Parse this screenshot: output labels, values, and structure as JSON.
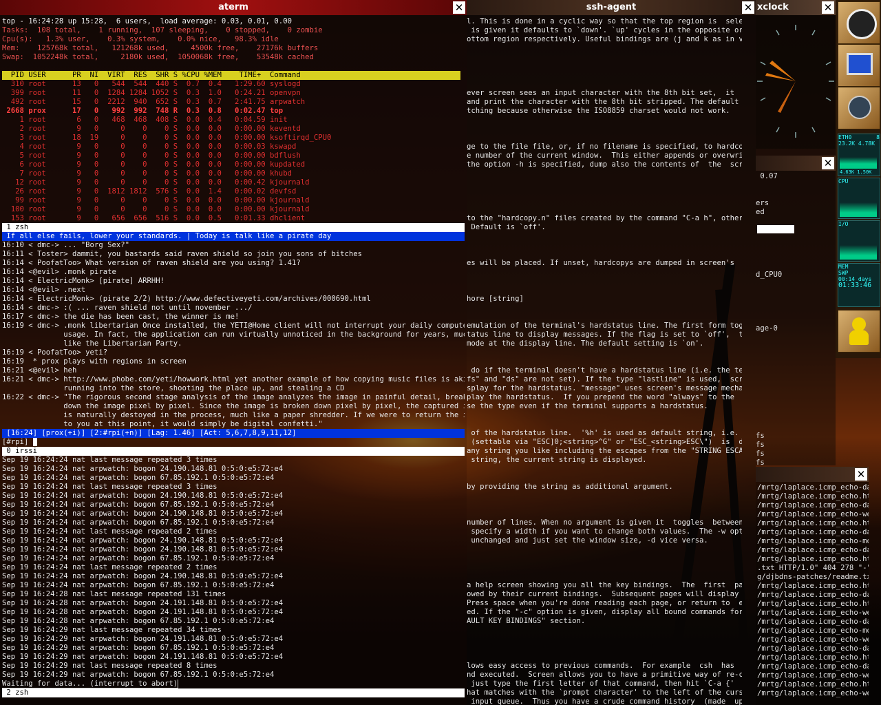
{
  "top_window": {
    "title": "aterm",
    "header": [
      "top - 16:24:28 up 15:28,  6 users,  load average: 0.03, 0.01, 0.00",
      "Tasks:  108 total,    1 running,  107 sleeping,    0 stopped,    0 zombie",
      "Cpu(s):   1.3% user,    0.3% system,    0.0% nice,   98.3% idle",
      "Mem:    125768k total,   121268k used,     4500k free,    27176k buffers",
      "Swap:  1052248k total,     2180k used,  1050068k free,    53548k cached"
    ],
    "columns_header": "  PID USER      PR  NI  VIRT  RES  SHR S %CPU %MEM    TIME+  Command          ",
    "processes": [
      "  310 root      13   0   544  544  440 S  0.7  0.4   1:29.60 syslogd",
      "  399 root      11   0  1284 1284 1052 S  0.3  1.0   0:24.21 openvpn",
      "  492 root      15   0  2212  940  652 S  0.3  0.7   2:41.75 arpwatch",
      " 2668 prox      17   0   992  992  748 R  0.3  0.8   0:02.47 top",
      "    1 root       6   0   468  468  408 S  0.0  0.4   0:04.59 init",
      "    2 root       9   0     0    0    0 S  0.0  0.0   0:00.00 keventd",
      "    3 root      18  19     0    0    0 S  0.0  0.0   0:00.00 ksoftirqd_CPU0",
      "    4 root       9   0     0    0    0 S  0.0  0.0   0:00.03 kswapd",
      "    5 root       9   0     0    0    0 S  0.0  0.0   0:00.00 bdflush",
      "    6 root       9   0     0    0    0 S  0.0  0.0   0:00.00 kupdated",
      "    7 root       9   0     0    0    0 S  0.0  0.0   0:00.00 khubd",
      "   12 root       9   0     0    0    0 S  0.0  0.0   0:00.42 kjournald",
      "   26 root       9   0  1812 1812  576 S  0.0  1.4   0:00.02 devfsd",
      "   99 root       9   0     0    0    0 S  0.0  0.0   0:00.00 kjournald",
      "  100 root       9   0     0    0    0 S  0.0  0.0   0:00.00 kjournald",
      "  153 root       9   0   656  656  516 S  0.0  0.5   0:01.33 dhclient"
    ],
    "screen_bar_1": " 1 zsh",
    "irssi_topic": " If all else fails, lower your standards. | Today is talk like a pirate day",
    "irssi_lines": [
      "16:10 < dmc-> ... \"Borg Sex?\"",
      "16:11 < Toster> dammit, you bastards said raven shield so join you sons of bitches",
      "16:14 < PoofatToo> What version of raven shield are you using? 1.41?",
      "16:14 <@evil> .monk pirate",
      "16:14 < ElectricMonk> [pirate] ARRHH!",
      "16:14 <@evil> .next",
      "16:14 < ElectricMonk> (pirate 2/2) http://www.defectiveyeti.com/archives/000690.html",
      "16:14 < dmc-> :( ... raven shield not until november .../",
      "16:17 < dmc-> the die has been cast, the winner is me!",
      "16:19 < dmc-> .monk libertarian Once installed, the YETI@Home client will not interrupt your daily computer",
      "              usage. In fact, the application can run virtually unnoticed in the background for years, much",
      "              like the Libertarian Party.",
      "16:19 < PoofatToo> yeti?",
      "16:19  * prox plays with regions in screen",
      "16:21 <@evil> heh",
      "16:21 < dmc-> http://www.phobe.com/yeti/howwork.html yet another example of how copying music files is akin to",
      "              running into the store, shooting the place up, and stealing a CD",
      "16:22 < dmc-> \"The rigorous second stage analysis of the image analyzes the image in painful detail, breaking",
      "              down the image pixel by pixel. Since the image is broken down pixel by pixel, the captured image",
      "              is naturally destoyed in the process, much like a paper shredder. If we were to return the image",
      "              to you at this point, it would simply be digital confetti.\""
    ],
    "irssi_status": " [16:24] [prox(+i)] [2:#rpi(+n)] [Lag: 1.46] [Act: 5,6,7,8,9,11,12]",
    "irssi_prompt": "[#rpi] ",
    "screen_bar_2": " 0 irssi",
    "log_lines": [
      "Sep 19 16:24:24 nat last message repeated 3 times",
      "Sep 19 16:24:24 nat arpwatch: bogon 24.190.148.81 0:5:0:e5:72:e4",
      "Sep 19 16:24:24 nat arpwatch: bogon 67.85.192.1 0:5:0:e5:72:e4",
      "Sep 19 16:24:24 nat last message repeated 3 times",
      "Sep 19 16:24:24 nat arpwatch: bogon 24.190.148.81 0:5:0:e5:72:e4",
      "Sep 19 16:24:24 nat arpwatch: bogon 67.85.192.1 0:5:0:e5:72:e4",
      "Sep 19 16:24:24 nat arpwatch: bogon 24.190.148.81 0:5:0:e5:72:e4",
      "Sep 19 16:24:24 nat arpwatch: bogon 67.85.192.1 0:5:0:e5:72:e4",
      "Sep 19 16:24:24 nat last message repeated 2 times",
      "Sep 19 16:24:24 nat arpwatch: bogon 24.190.148.81 0:5:0:e5:72:e4",
      "Sep 19 16:24:24 nat arpwatch: bogon 24.190.148.81 0:5:0:e5:72:e4",
      "Sep 19 16:24:24 nat arpwatch: bogon 67.85.192.1 0:5:0:e5:72:e4",
      "Sep 19 16:24:24 nat last message repeated 2 times",
      "Sep 19 16:24:24 nat arpwatch: bogon 24.190.148.81 0:5:0:e5:72:e4",
      "Sep 19 16:24:24 nat arpwatch: bogon 67.85.192.1 0:5:0:e5:72:e4",
      "Sep 19 16:24:28 nat last message repeated 131 times",
      "Sep 19 16:24:28 nat arpwatch: bogon 24.191.148.81 0:5:0:e5:72:e4",
      "Sep 19 16:24:28 nat arpwatch: bogon 24.191.148.81 0:5:0:e5:72:e4",
      "Sep 19 16:24:28 nat arpwatch: bogon 67.85.192.1 0:5:0:e5:72:e4",
      "Sep 19 16:24:29 nat last message repeated 34 times",
      "Sep 19 16:24:29 nat arpwatch: bogon 24.191.148.81 0:5:0:e5:72:e4",
      "Sep 19 16:24:29 nat arpwatch: bogon 67.85.192.1 0:5:0:e5:72:e4",
      "Sep 19 16:24:29 nat arpwatch: bogon 24.191.148.81 0:5:0:e5:72:e4",
      "Sep 19 16:24:29 nat last message repeated 8 times",
      "Sep 19 16:24:29 nat arpwatch: bogon 67.85.192.1 0:5:0:e5:72:e4"
    ],
    "log_waiting": "Waiting for data... (interrupt to abort)",
    "screen_bar_3": " 2 zsh"
  },
  "ssh_window": {
    "title": "ssh-agent",
    "lines": [
      "l. This is done in a cyclic way so that the top region is  selected",
      " is given it defaults to `down'. `up' cycles in the opposite order,",
      "ottom region respectively. Useful bindings are (j and k as in vi)",
      "",
      "",
      "",
      "",
      "",
      "ever screen sees an input character with the 8th bit set,  it  will",
      "and print the character with the 8th bit stripped. The default (see",
      "tching because otherwise the ISO8859 charset would not work.",
      "",
      "",
      "",
      "ge to the file file, or, if no filename is specified, to hardcopy.n",
      "e number of the current window.  This either appends or overwrites",
      "the option -h is specified, dump also the contents of  the  scroll-",
      "",
      "",
      "",
      "",
      "",
      "to the \"hardcopy.n\" files created by the command \"C-a h\", otherwise",
      " Default is `off'.",
      "",
      "",
      "",
      "es will be placed. If unset, hardcopys are dumped in screen's  cur-",
      "",
      "",
      "",
      "hore [string]",
      "",
      "",
      "emulation of the terminal's hardstatus line. The first form toggles",
      "tatus line to display messages. If the flag is set to `off',  these",
      "mode at the display line. The default setting is `on'.",
      "",
      "",
      " do if the terminal doesn't have a hardstatus line (i.e. the term-",
      "fs\" and \"ds\" are not set). If the type \"lastline\" is used,  screen",
      "splay for the hardstatus. \"message\" uses screen's message mechanism",
      "play the hardstatus.  If you prepend the word \"always\" to the  type",
      "se the type even if the terminal supports a hardstatus.",
      "",
      "",
      " of the hardstatus line.  '%h' is used as default string, i.e. the",
      " (settable via \"ESC]0;<string>^G\" or \"ESC_<string>ESC\\\")  is  dis-",
      "any string you like including the escapes from the \"STRING ESCAPES\"",
      " string, the current string is displayed.",
      "",
      "",
      "by providing the string as additional argument.",
      "",
      "",
      "",
      "number of lines. When no argument is given it  toggles  between  24",
      " specify a width if you want to change both values.  The -w option",
      " unchanged and just set the window size, -d vice versa.",
      "",
      "",
      "",
      "",
      "a help screen showing you all the key bindings.  The  first  pages",
      "owed by their current bindings.  Subsequent pages will display the",
      "Press space when you're done reading each page, or return to  exit",
      "ed. If the \"-c\" option is given, display all bound commands for the",
      "AULT KEY BINDINGS\" section.",
      "",
      "",
      "",
      "",
      "lows easy access to previous commands.  For example  csh  has  the",
      "nd executed.  Screen allows you to have a primitive way of re-call-",
      " just type the first letter of that command, then hit `C-a {'  and",
      "hat matches with the `prompt character' to the left of the cursor,",
      " input queue.  Thus you have a crude command history  (made  up  by",
      "buffer)."
    ]
  },
  "xclock": {
    "title": "xclock"
  },
  "middle_window": {
    "lines": [
      " 0.07",
      "",
      "",
      "ers",
      "ed",
      "",
      "",
      "",
      "",
      "",
      "",
      "d_CPU0",
      "",
      "",
      "",
      "",
      "",
      "age-0",
      "",
      "",
      "",
      "",
      "",
      "",
      "",
      "",
      "",
      "",
      "",
      "fs",
      "fs",
      "fs",
      "fs",
      "fs"
    ]
  },
  "mrtg_window": {
    "lines": [
      "/mrtg/laplace.icmp_echo-da",
      "/mrtg/laplace.icmp_echo.ht",
      "/mrtg/laplace.icmp_echo-da",
      "/mrtg/laplace.icmp_echo-we",
      "/mrtg/laplace.icmp_echo.ht",
      "/mrtg/laplace.icmp_echo-da",
      "/mrtg/laplace.icmp_echo-mo",
      "/mrtg/laplace.icmp_echo-da",
      "/mrtg/laplace.icmp_echo.ht",
      ".txt HTTP/1.0\" 404 278 \"-\"",
      "g/djbdns-patches/readme.txt",
      "/mrtg/laplace.icmp_echo.ht",
      "/mrtg/laplace.icmp_echo-da",
      "/mrtg/laplace.icmp_echo.ht",
      "/mrtg/laplace.icmp_echo-we",
      "/mrtg/laplace.icmp_echo-da",
      "/mrtg/laplace.icmp_echo-mo",
      "/mrtg/laplace.icmp_echo-we",
      "/mrtg/laplace.icmp_echo-da",
      "/mrtg/laplace.icmp_echo.ht",
      "/mrtg/laplace.icmp_echo-da",
      "/mrtg/laplace.icmp_echo-we",
      "/mrtg/laplace.icmp_echo.ht",
      "/mrtg/laplace.icmp_echo-we"
    ]
  },
  "dock": {
    "eth_label": "ETH0",
    "eth_num": "8",
    "eth_rx": "23.2K",
    "eth_tx": "4.78K",
    "eth_rx2": "4.63K",
    "eth_tx2": "1.50K",
    "cpu_label": "CPU",
    "io_label": "I/O",
    "mem_label": "MEM",
    "swp_label": "SWP",
    "uptime_days": "00:14 days",
    "uptime_time": "01:33:46"
  },
  "colors": {
    "aterm_title": "#8a0a0a",
    "ssh_title": "#3a2a20",
    "top_header_bar": "#d8d020",
    "irssi_blue": "#0033dd"
  }
}
